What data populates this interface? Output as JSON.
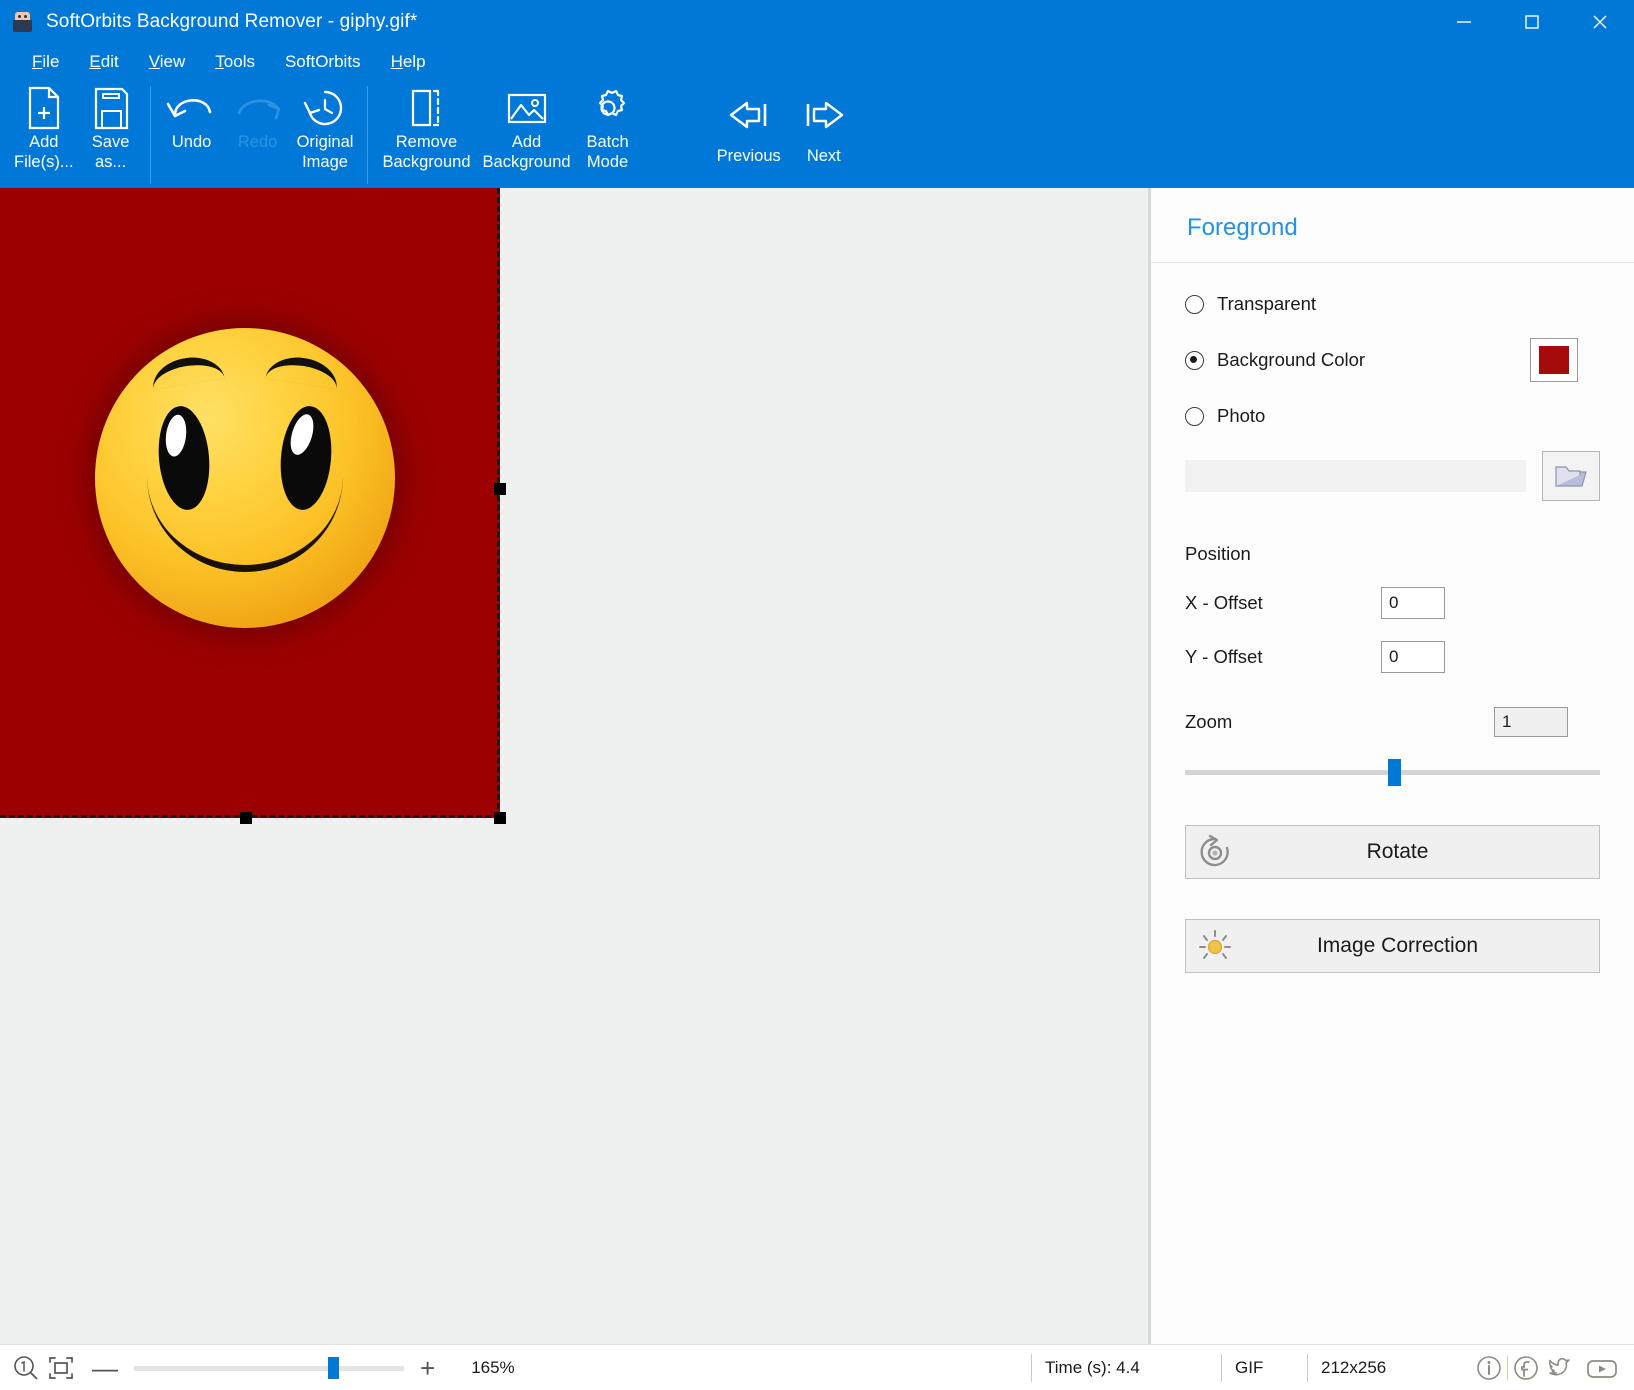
{
  "window": {
    "title": "SoftOrbits Background Remover - giphy.gif*",
    "app_icon": "app-logo-icon",
    "controls": {
      "minimize": "minimize-icon",
      "maximize": "maximize-icon",
      "close": "close-icon"
    }
  },
  "menubar": {
    "items": [
      {
        "label": "File",
        "accel": "F"
      },
      {
        "label": "Edit",
        "accel": "E"
      },
      {
        "label": "View",
        "accel": "V"
      },
      {
        "label": "Tools",
        "accel": "T"
      },
      {
        "label": "SoftOrbits",
        "accel": ""
      },
      {
        "label": "Help",
        "accel": "H"
      }
    ]
  },
  "toolbar": {
    "buttons": [
      {
        "id": "add-files",
        "label": "Add\nFile(s)...",
        "icon": "add-file-icon",
        "enabled": true
      },
      {
        "id": "save-as",
        "label": "Save\nas...",
        "icon": "save-icon",
        "enabled": true
      },
      {
        "id": "undo",
        "label": "Undo",
        "icon": "undo-arrow-icon",
        "enabled": true
      },
      {
        "id": "redo",
        "label": "Redo",
        "icon": "redo-arrow-icon",
        "enabled": false
      },
      {
        "id": "original-image",
        "label": "Original\nImage",
        "icon": "history-clock-icon",
        "enabled": true
      },
      {
        "id": "remove-background",
        "label": "Remove\nBackground",
        "icon": "remove-background-icon",
        "enabled": true
      },
      {
        "id": "add-background",
        "label": "Add\nBackground",
        "icon": "picture-icon",
        "enabled": true
      },
      {
        "id": "batch-mode",
        "label": "Batch\nMode",
        "icon": "gear-icon",
        "enabled": true
      },
      {
        "id": "previous",
        "label": "Previous",
        "icon": "arrow-left-icon",
        "enabled": true
      },
      {
        "id": "next",
        "label": "Next",
        "icon": "arrow-right-icon",
        "enabled": true
      }
    ]
  },
  "canvas": {
    "background_color": "#9c0000",
    "selection": "dashed-selection-border",
    "handles": [
      "right-middle-handle",
      "bottom-right-handle",
      "bottom-middle-handle"
    ],
    "image_alt": "yellow-smiley-face"
  },
  "panel": {
    "title": "Foregrond",
    "options": [
      {
        "id": "transparent",
        "label": "Transparent",
        "checked": false
      },
      {
        "id": "background-color",
        "label": "Background Color",
        "checked": true
      },
      {
        "id": "photo",
        "label": "Photo",
        "checked": false
      }
    ],
    "background_color_swatch": "#a50b0b",
    "photo_path": "",
    "photo_placeholder": "",
    "browse_icon": "folder-icon",
    "position_label": "Position",
    "x_offset_label": "X - Offset",
    "x_offset_value": "0",
    "y_offset_label": "Y - Offset",
    "y_offset_value": "0",
    "zoom_label": "Zoom",
    "zoom_value": "1",
    "zoom_slider_percent": 49,
    "rotate_label": "Rotate",
    "rotate_icon": "rotate-icon",
    "image_correction_label": "Image Correction",
    "image_correction_icon": "brightness-sun-icon"
  },
  "statusbar": {
    "zoom_icon": "zoom-1to1-icon",
    "fit_icon": "fit-to-window-icon",
    "minus": "—",
    "plus": "+",
    "zoom_percent": "165%",
    "zoom_slider_percent": 72,
    "time": "Time (s): 4.4",
    "format": "GIF",
    "dimensions": "212x256",
    "social": [
      "info-icon",
      "facebook-icon",
      "twitter-icon",
      "youtube-icon"
    ]
  },
  "colors": {
    "accent": "#0078d7",
    "canvas_red": "#9c0000",
    "panel_title": "#2092e8"
  }
}
